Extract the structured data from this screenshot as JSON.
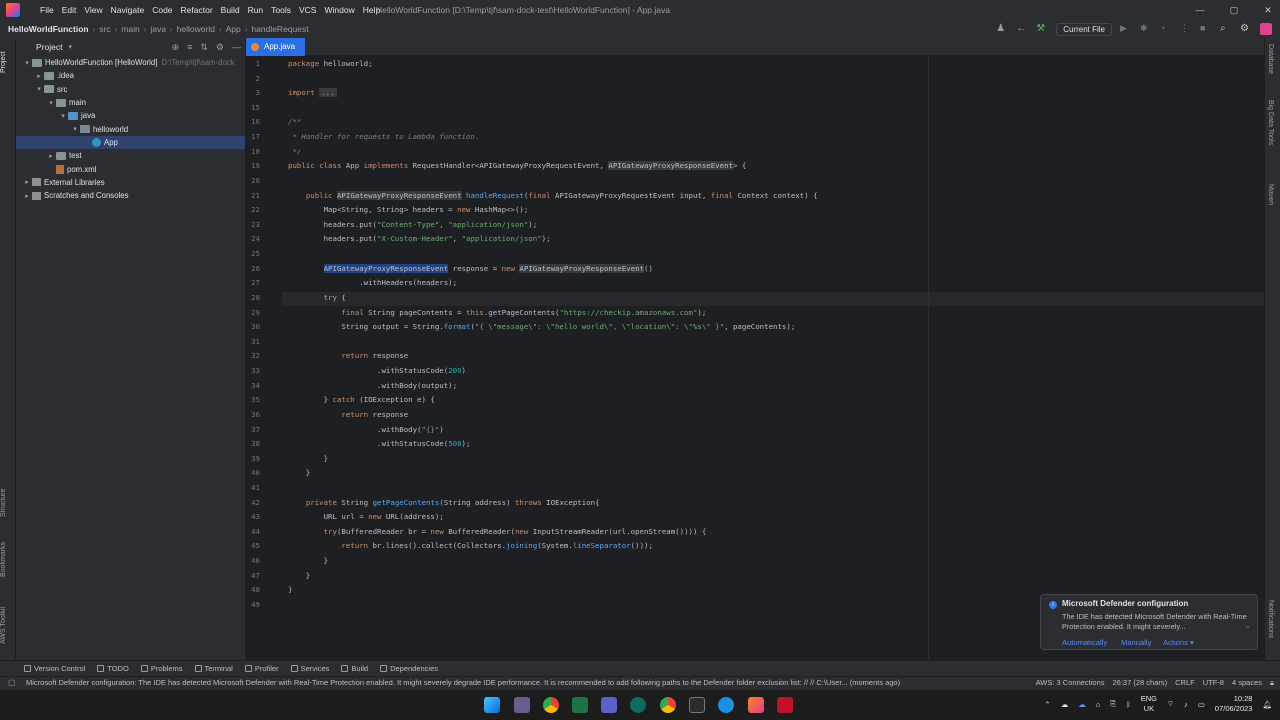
{
  "menu": [
    "File",
    "Edit",
    "View",
    "Navigate",
    "Code",
    "Refactor",
    "Build",
    "Run",
    "Tools",
    "VCS",
    "Window",
    "Help"
  ],
  "window_title": "HelloWorldFunction [D:\\Temp\\tjf\\sam-dock-test\\HelloWorldFunction] - App.java",
  "breadcrumb": [
    "HelloWorldFunction",
    "src",
    "main",
    "java",
    "helloworld",
    "App",
    "handleRequest"
  ],
  "run_config": "Current File",
  "project_panel": {
    "title": "Project",
    "tree": [
      {
        "label": "HelloWorldFunction [HelloWorld]",
        "hint": "D:\\Temp\\tjf\\sam-dock",
        "icon": "folder",
        "arrow": "▾",
        "indent": 0
      },
      {
        "label": ".idea",
        "icon": "folder",
        "arrow": "▸",
        "indent": 1
      },
      {
        "label": "src",
        "icon": "folder",
        "arrow": "▾",
        "indent": 1
      },
      {
        "label": "main",
        "icon": "folder",
        "arrow": "▾",
        "indent": 2
      },
      {
        "label": "java",
        "icon": "folder-blue",
        "arrow": "▾",
        "indent": 3
      },
      {
        "label": "helloworld",
        "icon": "package",
        "arrow": "▾",
        "indent": 4
      },
      {
        "label": "App",
        "icon": "class",
        "arrow": "",
        "indent": 5,
        "selected": true
      },
      {
        "label": "test",
        "icon": "folder",
        "arrow": "▸",
        "indent": 2
      },
      {
        "label": "pom.xml",
        "icon": "file",
        "arrow": "",
        "indent": 2
      },
      {
        "label": "External Libraries",
        "icon": "library",
        "arrow": "▸",
        "indent": 0
      },
      {
        "label": "Scratches and Consoles",
        "icon": "scratch",
        "arrow": "▸",
        "indent": 0
      }
    ]
  },
  "left_tabs": [
    "Project",
    "Structure",
    "Bookmarks",
    "AWS Toolkit"
  ],
  "right_tabs": [
    "Database",
    "Big Data Tools",
    "Maven",
    "Notifications"
  ],
  "editor_tab": "App.java",
  "code": [
    {
      "n": "1",
      "html": "<span class=\"kw\">package</span> helloworld;"
    },
    {
      "n": "2",
      "html": ""
    },
    {
      "n": "3",
      "html": "<span class=\"kw\">import</span> <span class=\"fold-tag\">...</span>"
    },
    {
      "n": "15",
      "html": ""
    },
    {
      "n": "16",
      "html": "<span class=\"cmt\">/**</span>"
    },
    {
      "n": "17",
      "html": "<span class=\"cmt\"> * Handler for requests to Lambda function.</span>"
    },
    {
      "n": "18",
      "html": "<span class=\"cmt\"> */</span>"
    },
    {
      "n": "19",
      "html": "<span class=\"kw\">public class</span> App <span class=\"kw\">implements</span> RequestHandler&lt;APIGatewayProxyRequestEvent, <span class=\"hl\">APIGatewayProxyResponseEvent</span>&gt; {"
    },
    {
      "n": "20",
      "html": ""
    },
    {
      "n": "21",
      "html": "    <span class=\"kw\">public</span> <span class=\"hl\">APIGatewayProxyResponseEvent</span> <span class=\"fn\">handleRequest</span>(<span class=\"kw\">final</span> APIGatewayProxyRequestEvent input, <span class=\"kw\">final</span> Context context) {"
    },
    {
      "n": "22",
      "html": "        Map&lt;String, String&gt; headers = <span class=\"kw\">new</span> HashMap&lt;&gt;();"
    },
    {
      "n": "23",
      "html": "        headers.put(<span class=\"str\">\"Content-Type\"</span>, <span class=\"str\">\"application/json\"</span>);"
    },
    {
      "n": "24",
      "html": "        headers.put(<span class=\"str\">\"X-Custom-Header\"</span>, <span class=\"str\">\"application/json\"</span>);"
    },
    {
      "n": "25",
      "html": ""
    },
    {
      "n": "26",
      "html": "        <span class=\"sel\">APIGatewayProxyResponseEvent</span> response = <span class=\"kw\">new</span> <span class=\"hl\">APIGatewayProxyResponseEvent</span>()"
    },
    {
      "n": "27",
      "html": "                .withHeaders(headers);"
    },
    {
      "n": "28",
      "html": "        <span class=\"kw\">try</span> {"
    },
    {
      "n": "29",
      "html": "            <span class=\"kw\">final</span> String pageContents = <span class=\"kw\">this</span>.getPageContents(<span class=\"str\">\"https://checkip.amazonaws.com\"</span>);"
    },
    {
      "n": "30",
      "html": "            String output = String.<span class=\"fn\">format</span>(<span class=\"str\">\"{ \\\"message\\\": \\\"hello world\\\", \\\"location\\\": \\\"%s\\\" }\"</span>, pageContents);"
    },
    {
      "n": "31",
      "html": ""
    },
    {
      "n": "32",
      "html": "            <span class=\"kw\">return</span> response"
    },
    {
      "n": "33",
      "html": "                    .withStatusCode(<span class=\"num\">200</span>)"
    },
    {
      "n": "34",
      "html": "                    .withBody(output);"
    },
    {
      "n": "35",
      "html": "        } <span class=\"kw\">catch</span> (IOException e) {"
    },
    {
      "n": "36",
      "html": "            <span class=\"kw\">return</span> response"
    },
    {
      "n": "37",
      "html": "                    .withBody(<span class=\"str\">\"{}\"</span>)"
    },
    {
      "n": "38",
      "html": "                    .withStatusCode(<span class=\"num\">500</span>);"
    },
    {
      "n": "39",
      "html": "        }"
    },
    {
      "n": "40",
      "html": "    }"
    },
    {
      "n": "41",
      "html": ""
    },
    {
      "n": "42",
      "html": "    <span class=\"kw\">private</span> String <span class=\"fn\">getPageContents</span>(String address) <span class=\"kw\">throws</span> IOException{"
    },
    {
      "n": "43",
      "html": "        URL url = <span class=\"kw\">new</span> URL(address);"
    },
    {
      "n": "44",
      "html": "        <span class=\"kw\">try</span>(BufferedReader br = <span class=\"kw\">new</span> BufferedReader(<span class=\"kw\">new</span> InputStreamReader(url.openStream()))) {"
    },
    {
      "n": "45",
      "html": "            <span class=\"kw\">return</span> br.lines().collect(Collectors.<span class=\"fn\">joining</span>(System.<span class=\"fn\">lineSeparator</span>()));"
    },
    {
      "n": "46",
      "html": "        }"
    },
    {
      "n": "47",
      "html": "    }"
    },
    {
      "n": "48",
      "html": "}"
    },
    {
      "n": "49",
      "html": ""
    }
  ],
  "notification": {
    "title": "Microsoft Defender configuration",
    "body": "The IDE has detected Microsoft Defender with Real-Time Protection enabled. It might severely...",
    "actions": [
      "Automatically",
      "Manually",
      "Actions ▾"
    ]
  },
  "bottom_tools": [
    "Version Control",
    "TODO",
    "Problems",
    "Terminal",
    "Profiler",
    "Services",
    "Build",
    "Dependencies"
  ],
  "status": {
    "message": "Microsoft Defender configuration: The IDE has detected Microsoft Defender with Real-Time Protection enabled. It might severely degrade IDE performance. It is recommended to add following paths to the Defender folder exclusion list: // // C:\\User... (moments ago)",
    "right": [
      "AWS: 3 Connections",
      "26:37 (28 chars)",
      "CRLF",
      "UTF-8",
      "4 spaces"
    ]
  },
  "taskbar": {
    "lang_line1": "ENG",
    "lang_line2": "UK",
    "time": "10:28",
    "date": "07/06/2023"
  }
}
